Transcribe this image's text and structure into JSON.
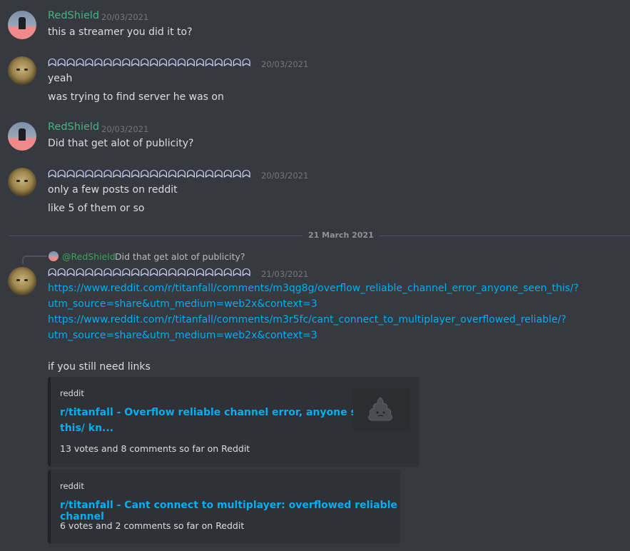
{
  "messages": [
    {
      "author": "RedShield",
      "timestamp": "20/03/2021",
      "lines": [
        "this a streamer you did it to?"
      ]
    },
    {
      "author": "ᗣᗣᗣᗣᗣᗣᗣᗣᗣᗣᗣᗣᗣᗣᗣᗣᗣᗣᗣᗣᗣᗣ",
      "timestamp": "20/03/2021",
      "lines": [
        "yeah",
        "was trying to find server he was on"
      ]
    },
    {
      "author": "RedShield",
      "timestamp": "20/03/2021",
      "lines": [
        "Did that get alot of publicity?"
      ]
    },
    {
      "author": "ᗣᗣᗣᗣᗣᗣᗣᗣᗣᗣᗣᗣᗣᗣᗣᗣᗣᗣᗣᗣᗣᗣ",
      "timestamp": "20/03/2021",
      "lines": [
        "only a few posts on reddit",
        "like 5 of them or so"
      ]
    }
  ],
  "divider": {
    "label": "21 March 2021"
  },
  "reply": {
    "mention": "@RedShield",
    "text": "Did that get alot of publicity?"
  },
  "last_message": {
    "author": "ᗣᗣᗣᗣᗣᗣᗣᗣᗣᗣᗣᗣᗣᗣᗣᗣᗣᗣᗣᗣᗣᗣ",
    "timestamp": "21/03/2021",
    "links": [
      "https://www.reddit.com/r/titanfall/comments/m3qg8g/overflow_reliable_channel_error_anyone_seen_this/?",
      "utm_source=share&utm_medium=web2x&context=3",
      "https://www.reddit.com/r/titanfall/comments/m3r5fc/cant_connect_to_multiplayer_overflowed_reliable/?",
      "utm_source=share&utm_medium=web2x&context=3"
    ],
    "text": "if you still need links",
    "embeds": [
      {
        "provider": "reddit",
        "title_line1": "r/titanfall - Overflow reliable channel error, anyone seen",
        "title_line2": "this/ kn...",
        "description": "13 votes and 8 comments so far on Reddit",
        "thumbnail_icon": "poop-icon"
      },
      {
        "provider": "reddit",
        "title_line1": "r/titanfall - Cant connect to multiplayer: overflowed reliable channel",
        "description": "6 votes and 2 comments so far on Reddit"
      }
    ]
  },
  "colors": {
    "background": "#36393f",
    "green_name": "#43b581",
    "link": "#00aff4",
    "embed_bg": "#2f3136"
  }
}
